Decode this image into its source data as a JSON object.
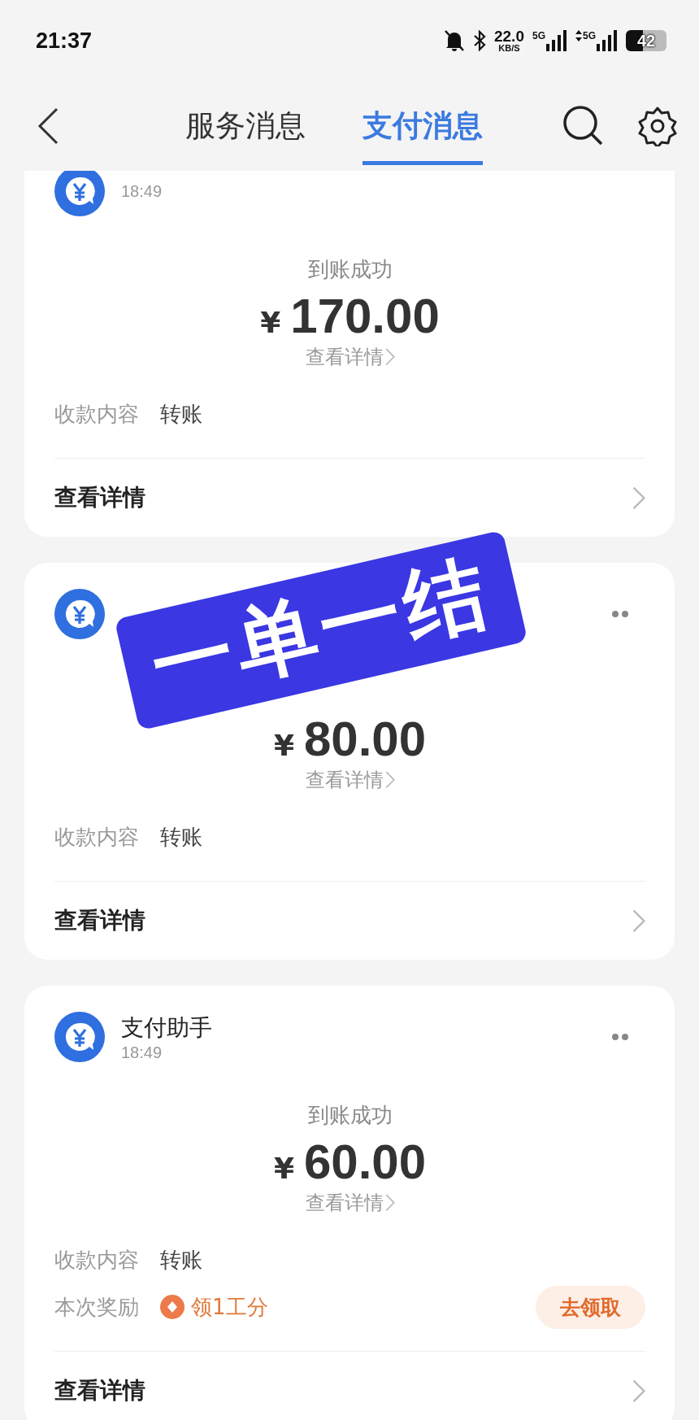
{
  "status_bar": {
    "time": "21:37",
    "net_speed": "22.0",
    "net_unit": "KB/S",
    "signal_1": "5G",
    "signal_2": "5G",
    "battery": "42"
  },
  "header": {
    "tabs": [
      {
        "label": "服务消息",
        "selected": false
      },
      {
        "label": "支付消息",
        "selected": true
      }
    ]
  },
  "messages": [
    {
      "time": "18:49",
      "status": "到账成功",
      "currency": "¥",
      "amount": "170.00",
      "link": "查看详情",
      "fields": [
        {
          "kind": "text",
          "label": "收款内容",
          "value": "转账"
        }
      ],
      "footer": "查看详情",
      "menu": false
    },
    {
      "currency": "¥",
      "amount": "80.00",
      "link": "查看详情",
      "fields": [
        {
          "kind": "text",
          "label": "收款内容",
          "value": "转账"
        }
      ],
      "footer": "查看详情",
      "menu": true
    },
    {
      "title": "支付助手",
      "time": "18:49",
      "status": "到账成功",
      "currency": "¥",
      "amount": "60.00",
      "link": "查看详情",
      "fields": [
        {
          "kind": "text",
          "label": "收款内容",
          "value": "转账"
        },
        {
          "kind": "reward",
          "label": "本次奖励",
          "value": "领1工分",
          "button": "去领取"
        }
      ],
      "footer": "查看详情",
      "menu": true
    }
  ],
  "stamp": {
    "text": "一单一结"
  }
}
